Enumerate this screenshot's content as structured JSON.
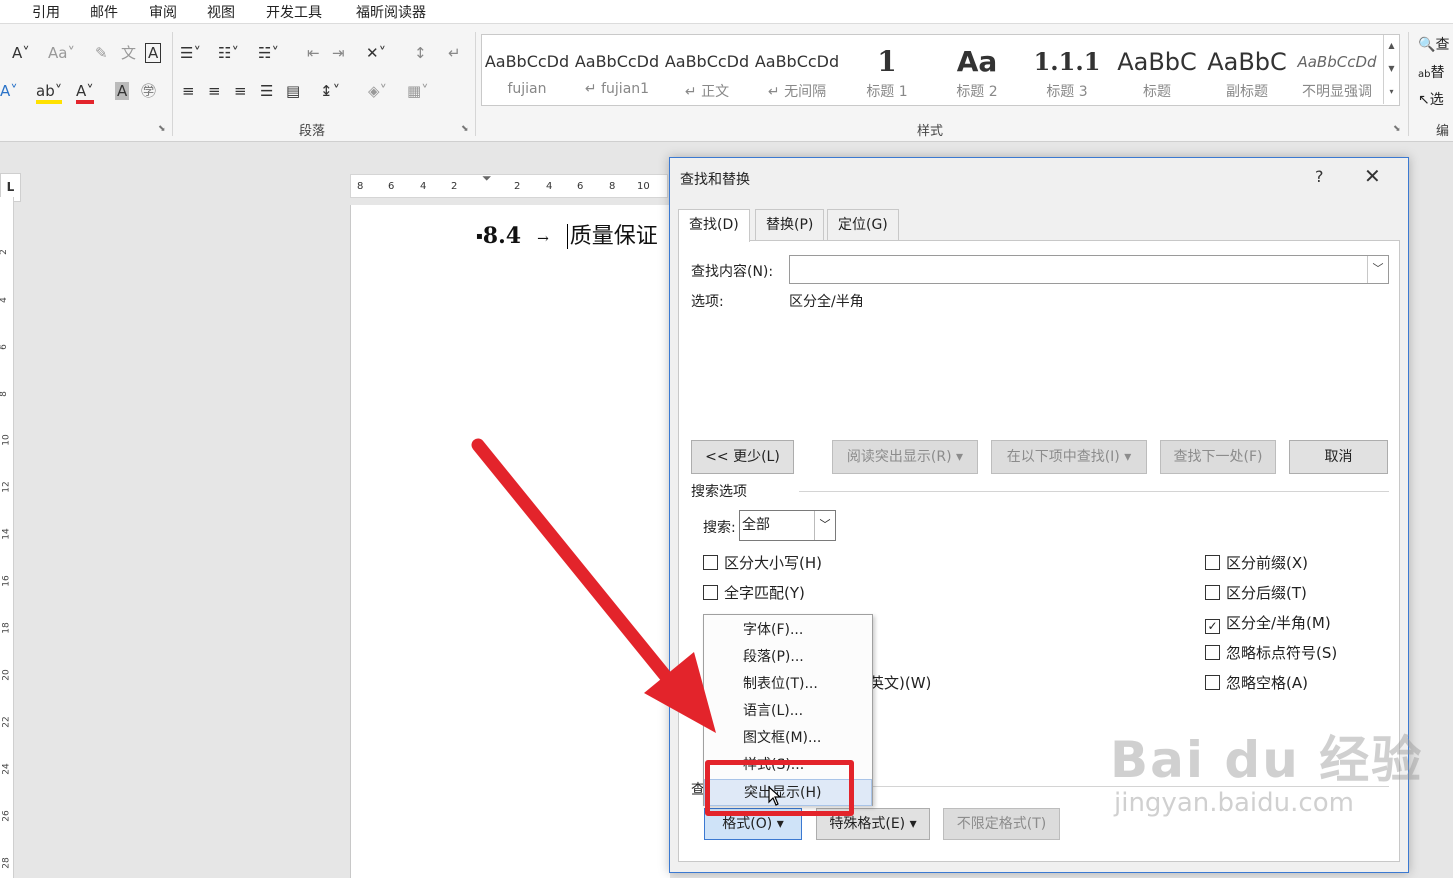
{
  "menubar": {
    "tabs": [
      "引用",
      "邮件",
      "审阅",
      "视图",
      "开发工具",
      "福昕阅读器"
    ]
  },
  "ribbon": {
    "paragraph_label": "段落",
    "styles_label": "样式",
    "editing_label": "编",
    "editing_items": [
      "查",
      "替",
      "选"
    ],
    "styles": [
      {
        "sample": "AaBbCcDd",
        "name": "fujian"
      },
      {
        "sample": "AaBbCcDd",
        "name": "fujian1"
      },
      {
        "sample": "AaBbCcDd",
        "name": "正文"
      },
      {
        "sample": "AaBbCcDd",
        "name": "无间隔"
      },
      {
        "sample": "1",
        "name": "标题 1"
      },
      {
        "sample": "Aa",
        "name": "标题 2"
      },
      {
        "sample": "1.1.1",
        "name": "标题 3"
      },
      {
        "sample": "AaBbC",
        "name": "标题"
      },
      {
        "sample": "AaBbC",
        "name": "副标题"
      },
      {
        "sample": "AaBbCcDd",
        "name": "不明显强调"
      }
    ]
  },
  "ruler": {
    "h_ticks": [
      "8",
      "6",
      "4",
      "2",
      "2",
      "4",
      "6",
      "8",
      "10"
    ],
    "v_ticks": [
      "2",
      "4",
      "6",
      "8",
      "10",
      "12",
      "14",
      "16",
      "18",
      "20",
      "22",
      "24",
      "26",
      "28"
    ]
  },
  "document": {
    "heading_number": "8.4",
    "heading_arrow": "→",
    "heading_text": "质量保证"
  },
  "dialog": {
    "title": "查找和替换",
    "help": "?",
    "close": "✕",
    "tabs": [
      "查找(D)",
      "替换(P)",
      "定位(G)"
    ],
    "find_label": "查找内容(N):",
    "find_value": "",
    "options_label": "选项:",
    "options_value": "区分全/半角",
    "buttons": {
      "less": "<< 更少(L)",
      "reading_highlight": "阅读突出显示(R)",
      "find_in": "在以下项中查找(I)",
      "find_next": "查找下一处(F)",
      "cancel": "取消"
    },
    "search_options_label": "搜索选项",
    "search_label": "搜索:",
    "search_value": "全部",
    "checks_left": [
      {
        "label": "区分大小写(H)",
        "checked": false
      },
      {
        "label": "全字匹配(Y)",
        "checked": false
      }
    ],
    "checks_right": [
      {
        "label": "区分前缀(X)",
        "checked": false
      },
      {
        "label": "区分后缀(T)",
        "checked": false
      },
      {
        "label": "区分全/半角(M)",
        "checked": true
      },
      {
        "label": "忽略标点符号(S)",
        "checked": false
      },
      {
        "label": "忽略空格(A)",
        "checked": false
      }
    ],
    "partial_hidden_text": "英文)(W)",
    "find_section_label": "查",
    "format_button": "格式(O)",
    "special_button": "特殊格式(E)",
    "no_format_button": "不限定格式(T)"
  },
  "format_menu": {
    "items": [
      "字体(F)...",
      "段落(P)...",
      "制表位(T)...",
      "语言(L)...",
      "图文框(M)...",
      "样式(S)...",
      "突出显示(H)"
    ],
    "hovered_index": 6
  },
  "watermark": {
    "line1": "Bai du 经验",
    "line2": "jingyan.baidu.com"
  },
  "colors": {
    "accent_red": "#e3242b",
    "dialog_border": "#3b79d1"
  }
}
